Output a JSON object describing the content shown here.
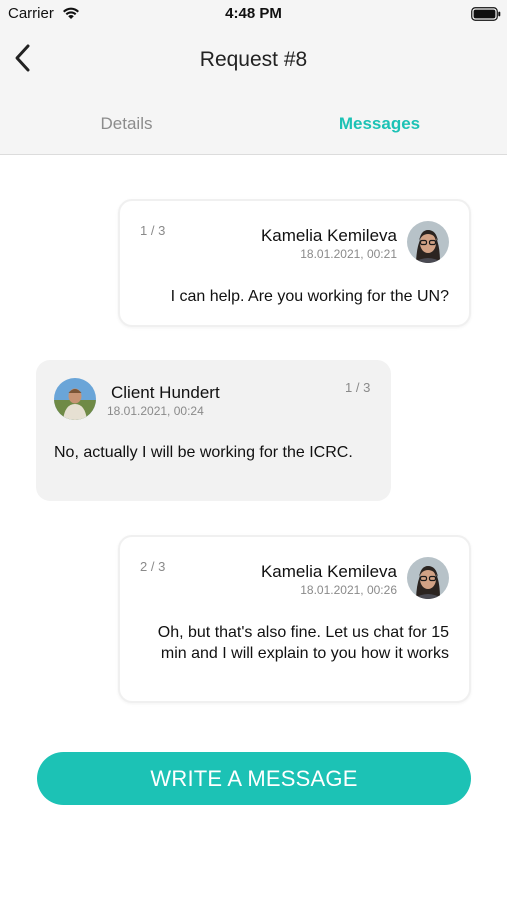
{
  "status_bar": {
    "carrier": "Carrier",
    "time": "4:48 PM"
  },
  "nav": {
    "title": "Request #8",
    "back_icon": "chevron-left-icon"
  },
  "tabs": [
    {
      "label": "Details",
      "active": false
    },
    {
      "label": "Messages",
      "active": true
    }
  ],
  "colors": {
    "accent": "#1cc2b5",
    "inactive_tab": "#8c8c8c",
    "incoming_bubble": "#f2f2f2"
  },
  "messages": [
    {
      "direction": "outgoing",
      "counter": "1 / 3",
      "sender": "Kamelia Kemileva",
      "timestamp": "18.01.2021, 00:21",
      "text": "I can help. Are you working for the UN?"
    },
    {
      "direction": "incoming",
      "counter": "1 / 3",
      "sender": "Client  Hundert",
      "timestamp": "18.01.2021, 00:24",
      "text": "No, actually I will be working for the ICRC."
    },
    {
      "direction": "outgoing",
      "counter": "2 / 3",
      "sender": "Kamelia Kemileva",
      "timestamp": "18.01.2021, 00:26",
      "text": "Oh, but that's also fine. Let us chat for 15 min and I will explain to you how it works"
    }
  ],
  "compose": {
    "button_label": "WRITE A MESSAGE"
  }
}
